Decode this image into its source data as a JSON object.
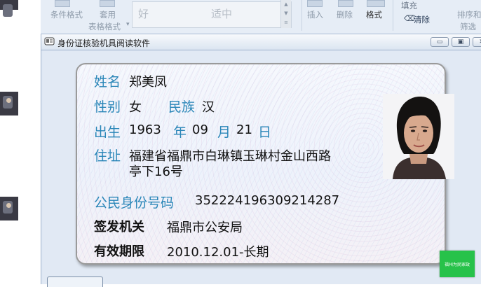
{
  "ribbon": {
    "conditional_format": "条件格式",
    "apply": "套用",
    "table_format": "表格格式",
    "style_good": "好",
    "style_neutral": "适中",
    "insert": "插入",
    "delete": "删除",
    "format": "格式",
    "fill": "填充",
    "clear": "清除",
    "sort_filter_1": "排序和",
    "sort_filter_2": "筛选"
  },
  "window": {
    "title": "身份证核验机具阅读软件"
  },
  "card": {
    "name_label": "姓名",
    "name_value": "郑美凤",
    "gender_label": "性别",
    "gender_value": "女",
    "ethnicity_label": "民族",
    "ethnicity_value": "汉",
    "birth_label": "出生",
    "birth_year": "1963",
    "year_char": "年",
    "birth_month": "09",
    "month_char": "月",
    "birth_day": "21",
    "day_char": "日",
    "address_label": "住址",
    "address_line1": "福建省福鼎市白琳镇玉琳村金山西路",
    "address_line2": "亭下16号",
    "id_label": "公民身份号码",
    "id_value": "352224196309214287",
    "issuer_label": "签发机关",
    "issuer_value": "福鼎市公安局",
    "validity_label": "有效期限",
    "validity_value": "2010.12.01-长期"
  },
  "badge": {
    "text": "福州为民家政"
  },
  "colors": {
    "label_blue": "#2a86b8",
    "ribbon_bg": "#e6edf6",
    "badge_green": "#27c24a"
  }
}
